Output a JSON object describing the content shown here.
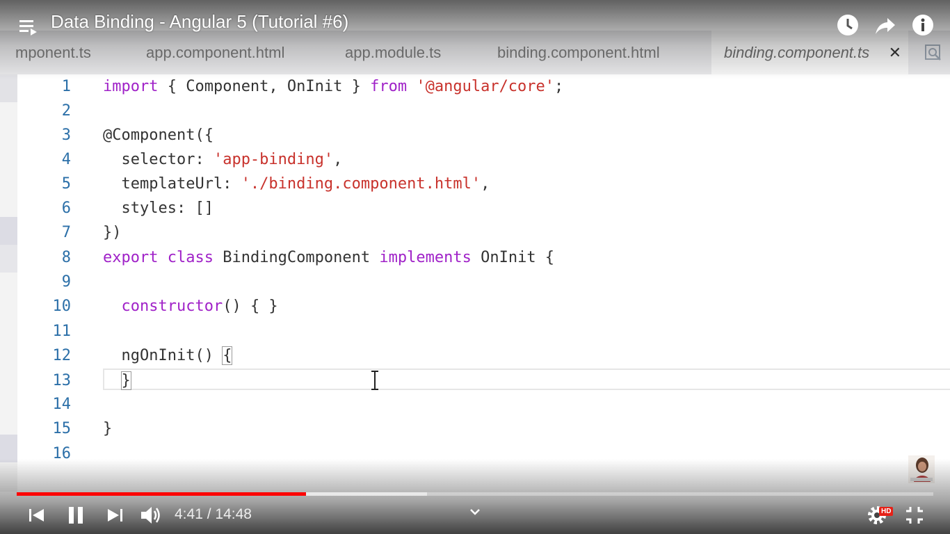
{
  "player": {
    "title": "Data Binding - Angular 5 (Tutorial #6)",
    "current_time": "4:41",
    "duration": "14:48",
    "time_separator": " / ",
    "progress_played_fraction": 0.316,
    "progress_buffered_fraction": 0.448,
    "quality_badge": "HD",
    "accent_color": "#ff0000",
    "icons": [
      "playlist-icon",
      "watch-later-icon",
      "share-icon",
      "info-icon",
      "previous-icon",
      "pause-icon",
      "next-icon",
      "volume-icon",
      "chevron-down-icon",
      "settings-icon",
      "exit-fullscreen-icon"
    ]
  },
  "editor": {
    "tabs": [
      {
        "label": "mponent.ts",
        "active": false
      },
      {
        "label": "app.component.html",
        "active": false
      },
      {
        "label": "app.module.ts",
        "active": false
      },
      {
        "label": "binding.component.html",
        "active": false
      },
      {
        "label": "binding.component.ts",
        "active": true
      }
    ],
    "close_glyph": "✕",
    "line_numbers": [
      "1",
      "2",
      "3",
      "4",
      "5",
      "6",
      "7",
      "8",
      "9",
      "10",
      "11",
      "12",
      "13",
      "14",
      "15",
      "16"
    ]
  }
}
